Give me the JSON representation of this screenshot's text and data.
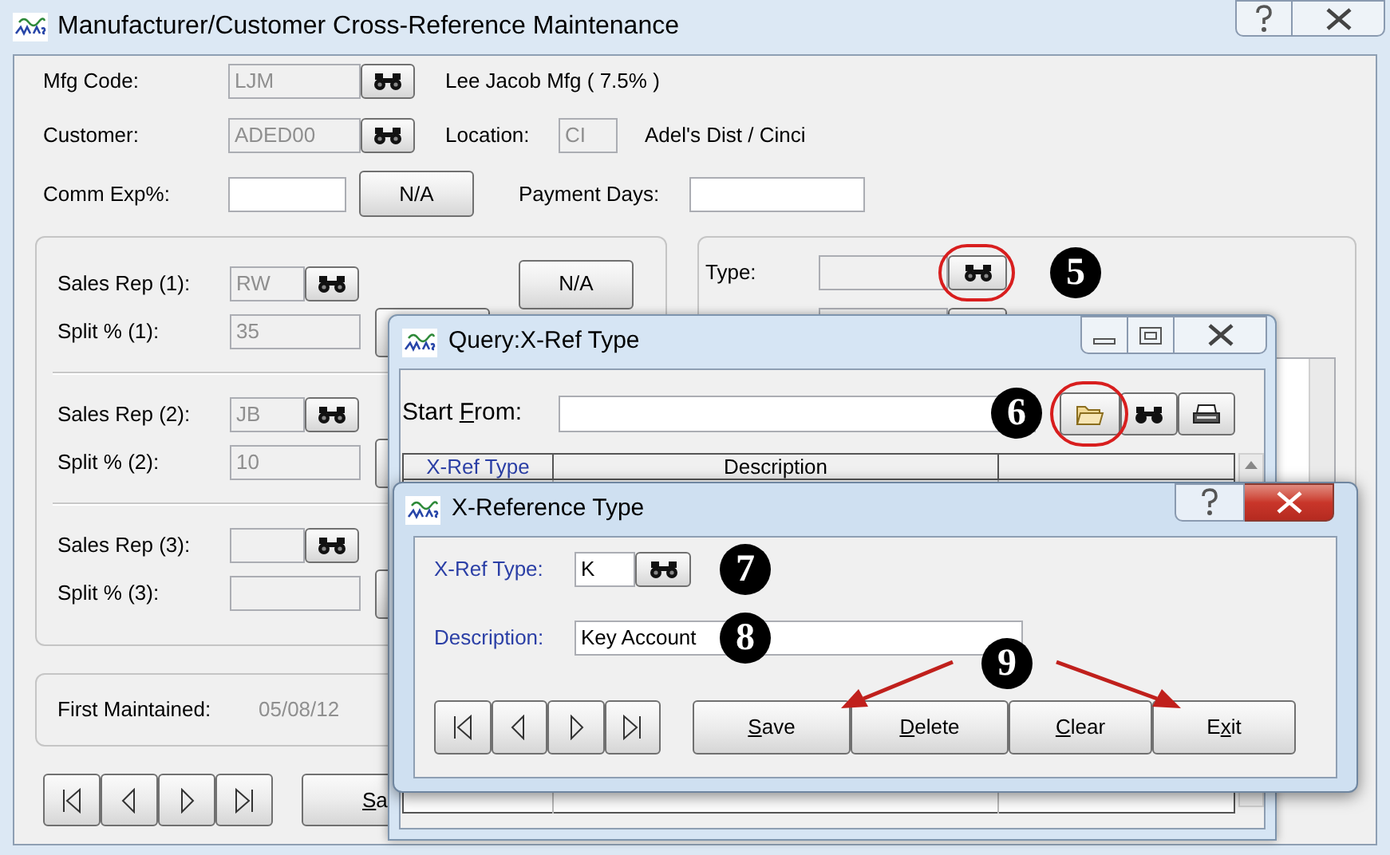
{
  "main_window": {
    "title": "Manufacturer/Customer Cross-Reference Maintenance",
    "mfg_code": {
      "label": "Mfg Code:",
      "value": "LJM",
      "disabled": true,
      "name": "Lee Jacob Mfg ( 7.5% )"
    },
    "customer": {
      "label": "Customer:",
      "value": "ADED00",
      "disabled": true
    },
    "location": {
      "label": "Location:",
      "value": "CI",
      "disabled": true,
      "name": "Adel's Dist / Cinci"
    },
    "comm_exp": {
      "label": "Comm Exp%:",
      "disabled": false,
      "button": "N/A"
    },
    "payment_days": {
      "label": "Payment Days:",
      "disabled": false
    },
    "sales_reps": [
      {
        "rep_label": "Sales Rep (1):",
        "rep": "RW",
        "split_label": "Split % (1):",
        "split": "35",
        "button": "N/A"
      },
      {
        "rep_label": "Sales Rep (2):",
        "rep": "JB",
        "split_label": "Split % (2):",
        "split": "10"
      },
      {
        "rep_label": "Sales Rep (3):",
        "split_label": "Split % (3):"
      }
    ],
    "type_panel": {
      "label": "Type:",
      "disabled": true,
      "highlighted": true,
      "marker": "5"
    },
    "first_maintained": {
      "label": "First Maintained:",
      "value": "05/08/12"
    },
    "save_button": {
      "key": "S",
      "post": "a"
    }
  },
  "query_window": {
    "title": "Query:X-Ref Type",
    "start_from": {
      "pre": "Start ",
      "key": "F",
      "post": "rom:"
    },
    "marker": "6",
    "folder_highlighted": true,
    "columns": [
      {
        "label": "X-Ref Type",
        "kind": "key"
      },
      {
        "label": "Description",
        "kind": "text"
      }
    ]
  },
  "xref_window": {
    "title": "X-Reference Type",
    "xref_type": {
      "label": "X-Ref Type:",
      "value": "K",
      "marker": "7"
    },
    "description": {
      "label": "Description:",
      "value": "Key Account",
      "marker": "8"
    },
    "buttons_marker": "9",
    "buttons": [
      {
        "key": "S",
        "post": "ave"
      },
      {
        "key": "D",
        "post": "elete"
      },
      {
        "key": "C",
        "post": "lear"
      },
      {
        "pre": "E",
        "key": "x",
        "post": "it"
      }
    ]
  }
}
